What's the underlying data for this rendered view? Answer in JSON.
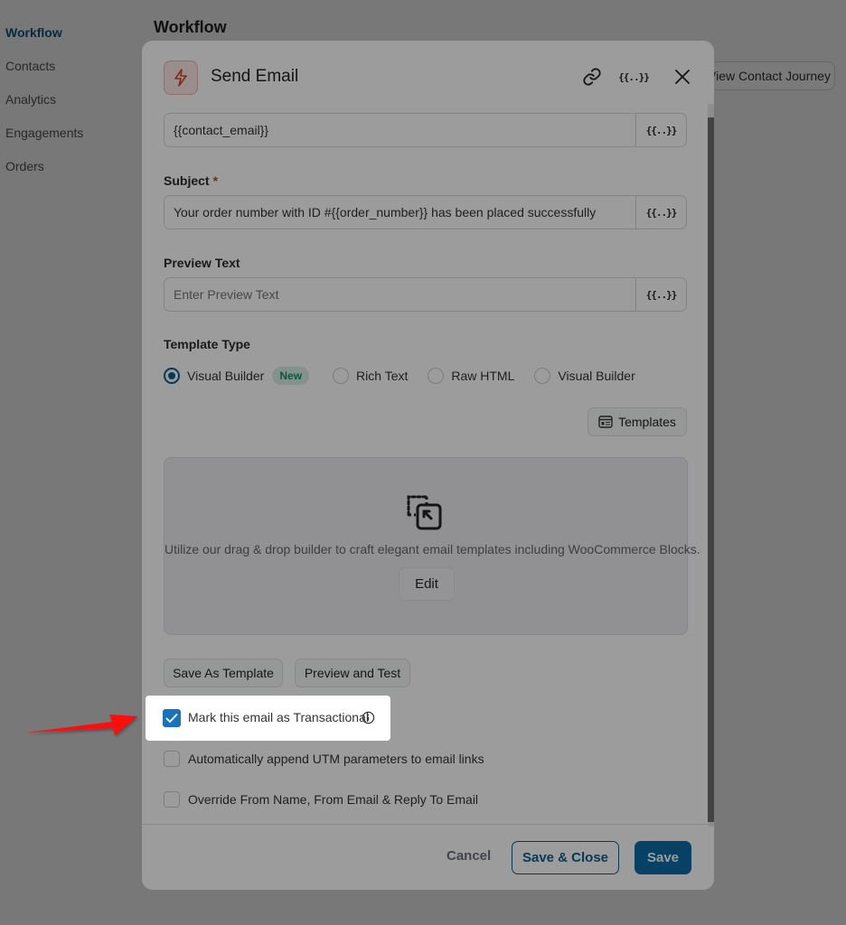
{
  "sidebar": {
    "items": [
      {
        "label": "Workflow",
        "active": true
      },
      {
        "label": "Contacts"
      },
      {
        "label": "Analytics"
      },
      {
        "label": "Engagements"
      },
      {
        "label": "Orders"
      }
    ]
  },
  "page": {
    "title": "Workflow",
    "view_journey_label": "View Contact Journey"
  },
  "modal": {
    "title": "Send Email",
    "header_icons": [
      "bolt-icon",
      "link-icon",
      "smart-code-icon",
      "close-icon"
    ],
    "smart_code_glyph": "{{..}}",
    "to_field": {
      "value": "{{contact_email}}"
    },
    "subject": {
      "label": "Subject",
      "required_mark": "*",
      "value": "Your order number with ID #{{order_number}} has been placed successfully"
    },
    "preview_text": {
      "label": "Preview Text",
      "placeholder": "Enter Preview Text",
      "value": ""
    },
    "template_type": {
      "label": "Template Type",
      "options": [
        {
          "label": "Visual Builder",
          "badge": "New",
          "checked": true
        },
        {
          "label": "Rich Text",
          "checked": false
        },
        {
          "label": "Raw HTML",
          "checked": false
        },
        {
          "label": "Visual Builder",
          "checked": false
        }
      ]
    },
    "templates_button": "Templates",
    "builder": {
      "description": "Utilize our drag & drop builder to craft elegant email templates including WooCommerce Blocks.",
      "edit_label": "Edit"
    },
    "actions": {
      "save_as_template": "Save As Template",
      "preview_and_test": "Preview and Test"
    },
    "options": [
      {
        "label": "Mark this email as Transactional",
        "checked": true,
        "has_info": true,
        "highlighted": true
      },
      {
        "label": "Automatically append UTM parameters to email links",
        "checked": false
      },
      {
        "label": "Override From Name, From Email & Reply To Email",
        "checked": false
      }
    ],
    "footer": {
      "cancel": "Cancel",
      "save_close": "Save & Close",
      "save": "Save"
    }
  },
  "colors": {
    "primary": "#0b6aa6",
    "checkbox_checked": "#1a73b8",
    "badge_text": "#1c8a6a",
    "annotation_arrow": "#ff0000"
  }
}
